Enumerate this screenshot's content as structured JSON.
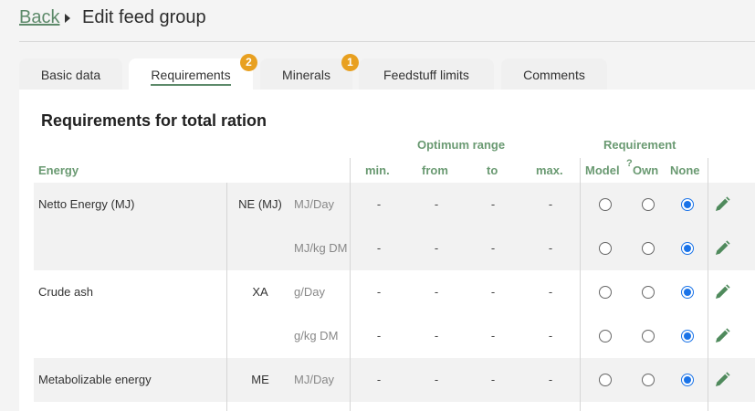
{
  "header": {
    "back_label": "Back",
    "title": "Edit feed group"
  },
  "tabs": [
    {
      "label": "Basic data",
      "badge": ""
    },
    {
      "label": "Requirements",
      "badge": "2"
    },
    {
      "label": "Minerals",
      "badge": "1"
    },
    {
      "label": "Feedstuff limits",
      "badge": ""
    },
    {
      "label": "Comments",
      "badge": ""
    }
  ],
  "active_tab": "Requirements",
  "section": {
    "title": "Requirements for total ration",
    "group_label": "Energy",
    "optimum_range_label": "Optimum range",
    "requirement_label": "Requirement",
    "columns": {
      "min": "min.",
      "from": "from",
      "to": "to",
      "max": "max.",
      "model": "Model",
      "help": "?",
      "own": "Own",
      "none": "None"
    }
  },
  "rows": [
    {
      "label": "Netto Energy (MJ)",
      "abbr": "NE (MJ)",
      "unit": "MJ/Day",
      "min": "-",
      "from": "-",
      "to": "-",
      "max": "-",
      "selected": "None"
    },
    {
      "label": "",
      "abbr": "",
      "unit": "MJ/kg DM",
      "min": "-",
      "from": "-",
      "to": "-",
      "max": "-",
      "selected": "None"
    },
    {
      "label": "Crude ash",
      "abbr": "XA",
      "unit": "g/Day",
      "min": "-",
      "from": "-",
      "to": "-",
      "max": "-",
      "selected": "None"
    },
    {
      "label": "",
      "abbr": "",
      "unit": "g/kg DM",
      "min": "-",
      "from": "-",
      "to": "-",
      "max": "-",
      "selected": "None"
    },
    {
      "label": "Metabolizable energy",
      "abbr": "ME",
      "unit": "MJ/Day",
      "min": "-",
      "from": "-",
      "to": "-",
      "max": "-",
      "selected": "None"
    }
  ],
  "colors": {
    "accent_green": "#6a9a72",
    "badge_orange": "#e8a020",
    "radio_blue": "#1a73e8",
    "pencil_green": "#4f8a5c"
  },
  "icons": {
    "row_action": "pencil-icon",
    "breadcrumb_separator": "caret-right-icon"
  }
}
